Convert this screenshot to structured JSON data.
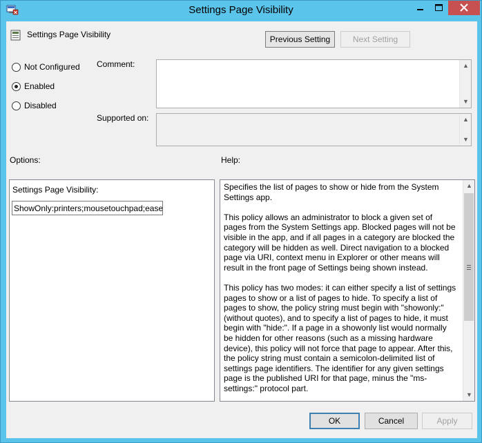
{
  "window": {
    "title": "Settings Page Visibility"
  },
  "header": {
    "setting_name": "Settings Page Visibility"
  },
  "nav": {
    "previous_label": "Previous Setting",
    "next_label": "Next Setting"
  },
  "state_options": [
    {
      "label": "Not Configured",
      "selected": false
    },
    {
      "label": "Enabled",
      "selected": true
    },
    {
      "label": "Disabled",
      "selected": false
    }
  ],
  "fields": {
    "comment_label": "Comment:",
    "supported_label": "Supported on:"
  },
  "sections": {
    "options_label": "Options:",
    "help_label": "Help:"
  },
  "options": {
    "field_label": "Settings Page Visibility:",
    "field_value": "ShowOnly:printers;mousetouchpad;ease"
  },
  "help": {
    "paragraphs": [
      "Specifies the list of pages to show or hide from the System Settings app.",
      "This policy allows an administrator to block a given set of pages from the System Settings app. Blocked pages will not be visible in the app, and if all pages in a category are blocked the category will be hidden as well. Direct navigation to a blocked page via URI, context menu in Explorer or other means will result in the front page of Settings being shown instead.",
      "This policy has two modes: it can either specify a list of settings pages to show or a list of pages to hide. To specify a list of pages to show, the policy string must begin with \"showonly:\" (without quotes), and to specify a list of pages to hide, it must begin with \"hide:\". If a page in a showonly list would normally be hidden for other reasons (such as a missing hardware device), this policy will not force that page to appear. After this, the policy string must contain a semicolon-delimited list of settings page identifiers. The identifier for any given settings page is the published URI for that page, minus the \"ms-settings:\" protocol part."
    ]
  },
  "buttons": {
    "ok_label": "OK",
    "cancel_label": "Cancel",
    "apply_label": "Apply"
  },
  "colors": {
    "frame": "#5ac4ea",
    "close_button": "#c75050",
    "client": "#f0f0f0"
  }
}
